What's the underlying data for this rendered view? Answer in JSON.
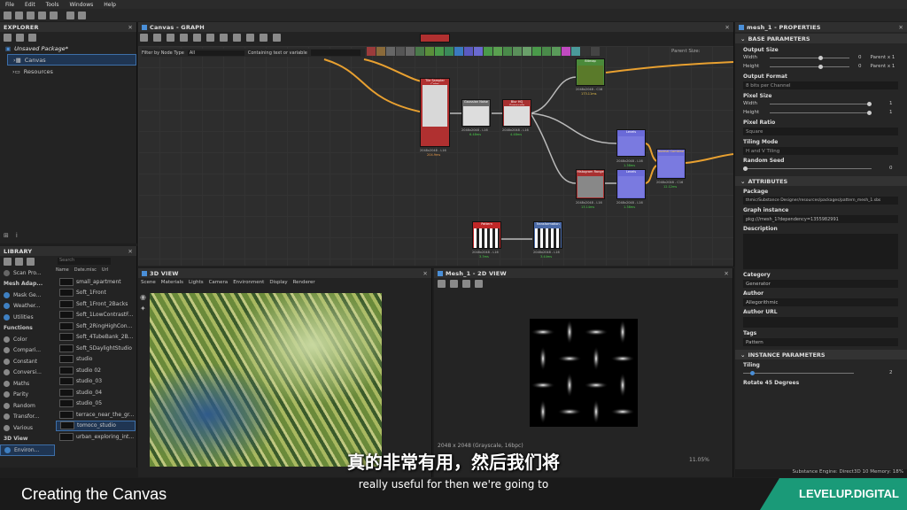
{
  "menu": [
    "File",
    "Edit",
    "Tools",
    "Windows",
    "Help"
  ],
  "explorer": {
    "title": "EXPLORER",
    "package": "Unsaved Package*",
    "items": [
      "Canvas",
      "Resources"
    ]
  },
  "graph": {
    "title": "Canvas - GRAPH",
    "filter_label": "Filter by Node Type",
    "filter_value": "All",
    "containing_label": "Containing text or variable",
    "parent_size": "Parent Size:",
    "nodes": [
      {
        "title": "Tile Sampler Color",
        "res": "2048x2048 - L16",
        "time": "204.9ms"
      },
      {
        "title": "Gaussian Noise",
        "res": "2048x2048 - L16",
        "time": "6.48ms"
      },
      {
        "title": "Blur HQ Grayscale",
        "res": "2048x2048 - L16",
        "time": "4.48ms"
      },
      {
        "title": "Bitmap",
        "res": "2048x2048 - C16",
        "time": "173.11ms"
      },
      {
        "title": "Levels",
        "res": "2048x2048 - L16",
        "time": "1.38ms"
      },
      {
        "title": "Normal Combine",
        "res": "2048x2048 - C16",
        "time": "12.12ms"
      },
      {
        "title": "Histogram Range",
        "res": "2048x2048 - L16",
        "time": "13.14ms"
      },
      {
        "title": "Levels",
        "res": "2048x2048 - L16",
        "time": "1.38ms"
      },
      {
        "title": "Pattern",
        "res": "2048x2048 - L16",
        "time": "3.3ms"
      },
      {
        "title": "Transformation",
        "res": "2048x2048 - L16",
        "time": "3.44ms"
      }
    ]
  },
  "library": {
    "title": "LIBRARY",
    "search_placeholder": "Search",
    "col_name": "Name",
    "col_date": "Date.misc",
    "col_url": "Url",
    "categories": [
      "Scan Pro...",
      "Mesh Adap...",
      "Mask Ge...",
      "Weather...",
      "Utilities",
      "Functions",
      "Color",
      "Compari...",
      "Constant",
      "Conversi...",
      "Maths",
      "Parity",
      "Random",
      "Transfor...",
      "Various",
      "3D View",
      "Environ..."
    ],
    "items": [
      "small_apartment",
      "Soft_1Front",
      "Soft_1Front_2Backs",
      "Soft_1LowContrastF...",
      "Soft_2RingHighCon...",
      "Soft_4TubeBank_2B...",
      "Soft_5DaylightStudio",
      "studio",
      "studio 02",
      "studio_03",
      "studio_04",
      "studio_05",
      "terrace_near_the_gr...",
      "tomoco_studio",
      "urban_exploring_int..."
    ]
  },
  "view3d": {
    "title": "3D VIEW",
    "menu": [
      "Scene",
      "Materials",
      "Lights",
      "Camera",
      "Environment",
      "Display",
      "Renderer"
    ]
  },
  "view2d": {
    "title": "Mesh_1 - 2D VIEW",
    "status": "2048 x 2048 (Grayscale, 16bpc)",
    "zoom": "11.05%"
  },
  "properties": {
    "title": "mesh_1 - PROPERTIES",
    "base": "BASE PARAMETERS",
    "output_size": "Output Size",
    "width": "Width",
    "height": "Height",
    "os_w": "0",
    "os_h": "0",
    "parent1": "Parent x 1",
    "parent2": "Parent x 1",
    "output_format": "Output Format",
    "of_value": "8 bits per Channel",
    "pixel_size": "Pixel Size",
    "ps_w": "1",
    "ps_h": "1",
    "pixel_ratio": "Pixel Ratio",
    "pr_value": "Square",
    "tiling_mode": "Tiling Mode",
    "tm_value": "H and V Tiling",
    "random_seed": "Random Seed",
    "rs_value": "0",
    "attributes": "ATTRIBUTES",
    "package": "Package",
    "package_value": "thmic/Substance Designer/resources/packages/pattern_mesh_1.sbs",
    "graph_instance": "Graph instance",
    "gi_value": "pkg:///mesh_1?dependency=1355982991",
    "description": "Description",
    "category": "Category",
    "category_value": "Generator",
    "author": "Author",
    "author_value": "Allegorithmic",
    "author_url": "Author URL",
    "tags": "Tags",
    "tags_value": "Pattern",
    "instance": "INSTANCE PARAMETERS",
    "tiling": "Tiling",
    "tiling_value": "2",
    "rotate": "Rotate 45 Degrees"
  },
  "status_bar": "Substance Engine: Direct3D 10   Memory: 18%",
  "subtitle_cn": "真的非常有用，然后我们将",
  "subtitle_en": "really useful for then we're going to",
  "lower_title": "Creating the Canvas",
  "brand": "LEVELUP.DIGITAL"
}
